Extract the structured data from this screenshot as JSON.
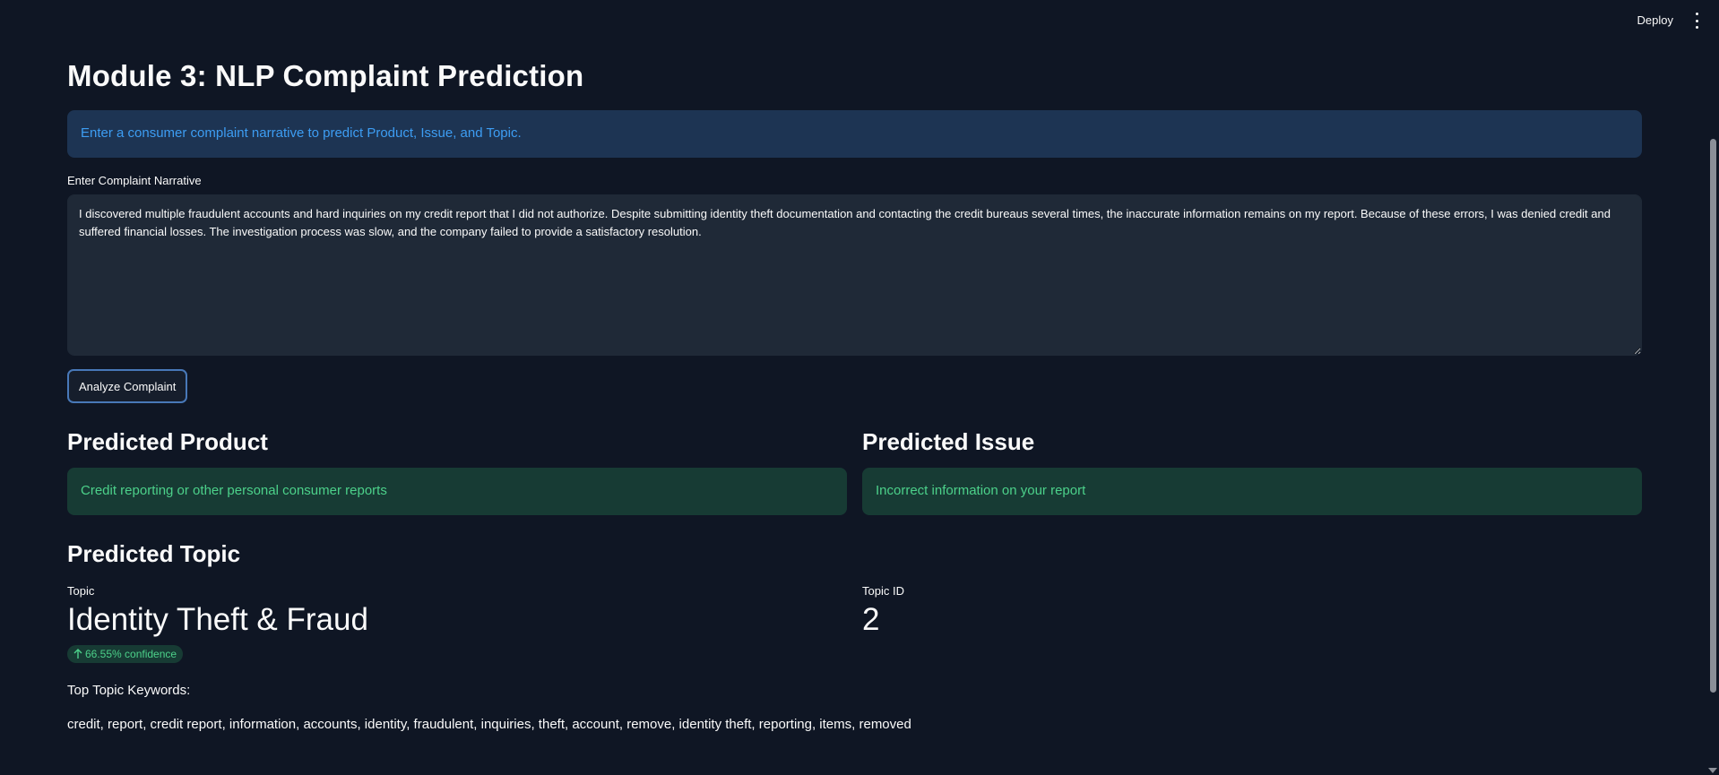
{
  "header": {
    "deploy_label": "Deploy",
    "menu_icon": "kebab-menu-icon"
  },
  "page": {
    "title": "Module 3: NLP Complaint Prediction",
    "info_text": "Enter a consumer complaint narrative to predict Product, Issue, and Topic."
  },
  "form": {
    "narrative_label": "Enter Complaint Narrative",
    "narrative_value": "I discovered multiple fraudulent accounts and hard inquiries on my credit report that I did not authorize. Despite submitting identity theft documentation and contacting the credit bureaus several times, the inaccurate information remains on my report. Because of these errors, I was denied credit and suffered financial losses. The investigation process was slow, and the company failed to provide a satisfactory resolution.",
    "analyze_label": "Analyze Complaint"
  },
  "results": {
    "product_heading": "Predicted Product",
    "product_value": "Credit reporting or other personal consumer reports",
    "issue_heading": "Predicted Issue",
    "issue_value": "Incorrect information on your report",
    "topic_heading": "Predicted Topic",
    "topic_label": "Topic",
    "topic_value": "Identity Theft & Fraud",
    "topic_delta": "66.55% confidence",
    "topic_id_label": "Topic ID",
    "topic_id_value": "2",
    "keywords_heading": "Top Topic Keywords:",
    "keywords": "credit, report, credit report, information, accounts, identity, fraudulent, inquiries, theft, account, remove, identity theft, reporting, items, removed"
  },
  "colors": {
    "background": "#0f1624",
    "info_bg": "#1d3453",
    "info_text": "#3d9df3",
    "success_bg": "#173b34",
    "success_text": "#4cd18a",
    "input_bg": "#1f2937",
    "button_border": "#4878b8"
  }
}
